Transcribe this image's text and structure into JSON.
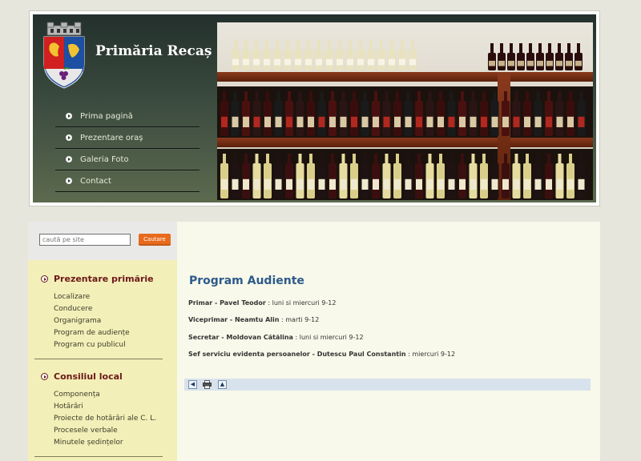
{
  "header": {
    "site_title": "Primăria Recaș",
    "nav": [
      {
        "label": "Prima pagină"
      },
      {
        "label": "Prezentare oraș"
      },
      {
        "label": "Galeria Foto"
      },
      {
        "label": "Contact"
      }
    ]
  },
  "search": {
    "placeholder": "caută pe site",
    "button_label": "Cautare"
  },
  "sidebar": {
    "sections": [
      {
        "title": "Prezentare primărie",
        "items": [
          "Localizare",
          "Conducere",
          "Organigrama",
          "Program de audiențe",
          "Program cu publicul"
        ]
      },
      {
        "title": "Consiliul local",
        "items": [
          "Componența",
          "Hotărâri",
          "Proiecte de hotărâri ale C. L.",
          "Procesele verbale",
          "Minutele ședințelor"
        ]
      }
    ]
  },
  "main": {
    "title": "Program Audiente",
    "rows": [
      {
        "name": "Primar - Pavel Teodor",
        "sep": " : ",
        "schedule": "luni si miercuri 9-12"
      },
      {
        "name": "Viceprimar - Neamtu Alin",
        "sep": " : ",
        "schedule": "marti 9-12"
      },
      {
        "name": "Secretar - Moldovan Cătălina",
        "sep": " : ",
        "schedule": "luni si miercuri 9-12"
      },
      {
        "name": "Sef serviciu evidenta persoanelor - Dutescu Paul Constantin",
        "sep": " : ",
        "schedule": "miercuri 9-12"
      }
    ]
  },
  "toolbar": {
    "icons": [
      "back-icon",
      "print-icon",
      "top-icon"
    ]
  },
  "colors": {
    "page_bg": "#e6e6dc",
    "sidebar_bg": "#f3efb8",
    "content_bg": "#f8f9ea",
    "accent_title": "#2d5a8c",
    "sidebar_heading": "#6b1818",
    "search_button": "#e86a1c"
  }
}
